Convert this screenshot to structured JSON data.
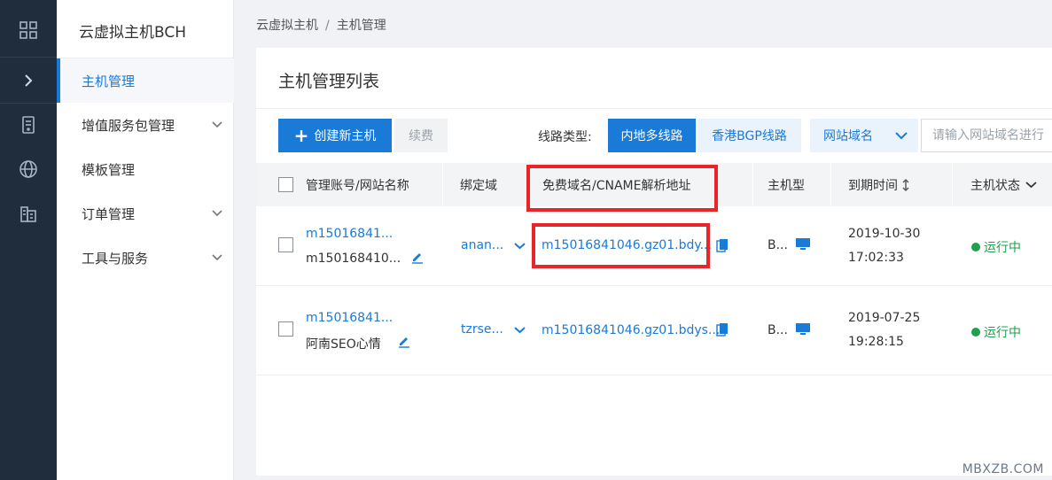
{
  "rail": {
    "items": [
      {
        "icon": "grid-icon"
      },
      {
        "icon": "chevron-right-icon"
      },
      {
        "icon": "server-icon"
      },
      {
        "icon": "globe-icon"
      },
      {
        "icon": "building-icon"
      }
    ]
  },
  "menu": {
    "title": "云虚拟主机BCH",
    "items": [
      {
        "label": "主机管理",
        "active": true
      },
      {
        "label": "增值服务包管理",
        "expandable": true
      },
      {
        "label": "模板管理"
      },
      {
        "label": "订单管理",
        "expandable": true
      },
      {
        "label": "工具与服务",
        "expandable": true
      }
    ]
  },
  "breadcrumb": {
    "parent": "云虚拟主机",
    "separator": "/",
    "current": "主机管理"
  },
  "page": {
    "title": "主机管理列表"
  },
  "toolbar": {
    "create_label": "创建新主机",
    "renew_label": "续费",
    "line_type_label": "线路类型:",
    "line_options": [
      "内地多线路",
      "香港BGP线路"
    ],
    "line_selected": "内地多线路",
    "search_field": "网站域名",
    "search_placeholder": "请输入网站域名进行"
  },
  "table": {
    "columns": [
      "管理账号/网站名称",
      "绑定域",
      "免费域名/CNAME解析地址",
      "主机型",
      "到期时间",
      "主机状态"
    ],
    "rows": [
      {
        "account": "m15016841...",
        "site_name": "m150168410...",
        "domain": "anan...",
        "cname": "m15016841046.gz01.bdy...",
        "type": "B...",
        "expire_date": "2019-10-30",
        "expire_time": "17:02:33",
        "status": "运行中"
      },
      {
        "account": "m15016841...",
        "site_name": "阿南SEO心情",
        "domain": "tzrse...",
        "cname": "m15016841046.gz01.bdys...",
        "type": "B...",
        "expire_date": "2019-07-25",
        "expire_time": "19:28:15",
        "status": "运行中"
      }
    ]
  },
  "colors": {
    "accent": "#1a7ad8",
    "rail_bg": "#1f2d3d",
    "status_green": "#1fa04a",
    "highlight_red": "#e8262a"
  },
  "watermark": "MBXZB.COM"
}
